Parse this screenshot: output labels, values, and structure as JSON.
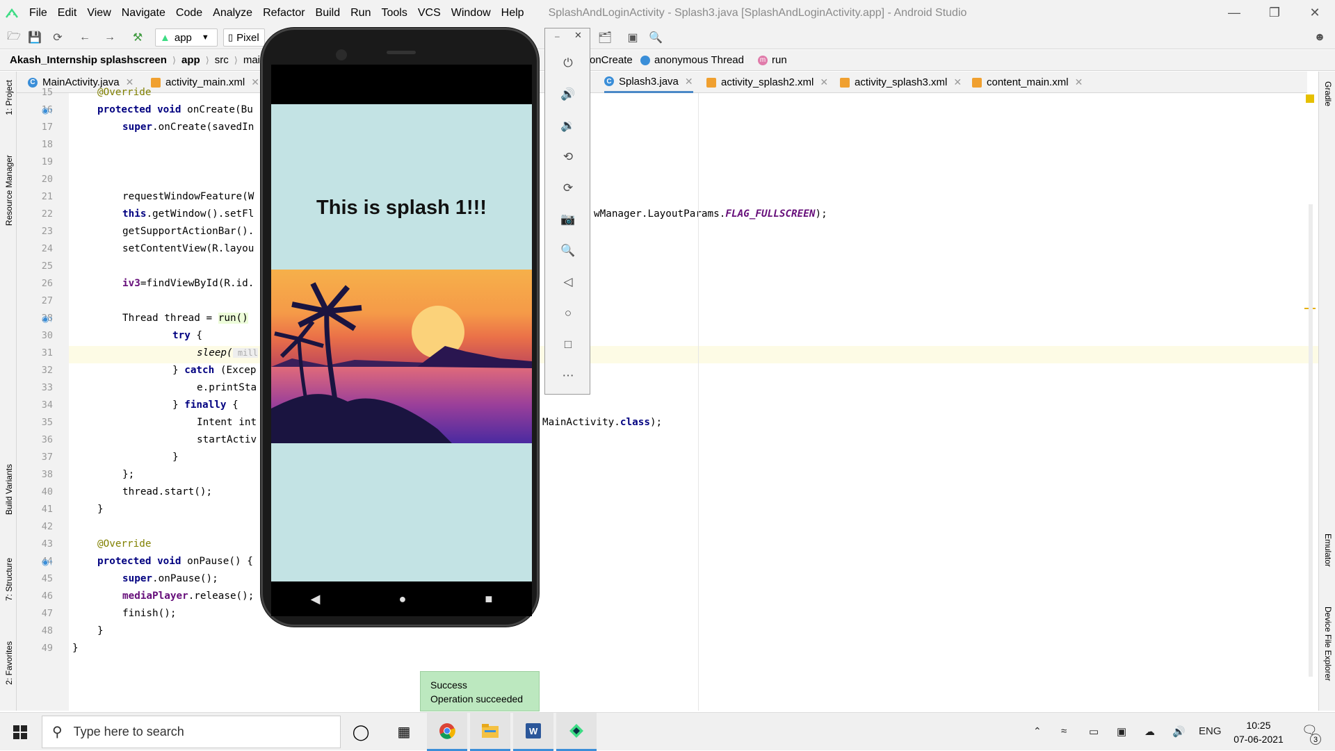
{
  "window": {
    "title": "SplashAndLoginActivity - Splash3.java [SplashAndLoginActivity.app] - Android Studio",
    "menu": [
      "File",
      "Edit",
      "View",
      "Navigate",
      "Code",
      "Analyze",
      "Refactor",
      "Build",
      "Run",
      "Tools",
      "VCS",
      "Window",
      "Help"
    ]
  },
  "toolbar": {
    "run_config": "app",
    "device": "Pixel"
  },
  "breadcrumb": {
    "project": "Akash_Internship splashscreen",
    "module": "app",
    "src": "src",
    "main": "main",
    "method": "onCreate",
    "anon": "anonymous Thread",
    "run": "run"
  },
  "tabs": [
    {
      "label": "MainActivity.java",
      "type": "java"
    },
    {
      "label": "activity_main.xml",
      "type": "xml"
    },
    {
      "label": "Splash3.java",
      "type": "java",
      "active": true
    },
    {
      "label": "activity_splash2.xml",
      "type": "xml"
    },
    {
      "label": "activity_splash3.xml",
      "type": "xml"
    },
    {
      "label": "content_main.xml",
      "type": "xml"
    }
  ],
  "side_tools": {
    "project": "1: Project",
    "resource_manager": "Resource Manager",
    "build_variants": "Build Variants",
    "structure": "7: Structure",
    "favorites": "2: Favorites",
    "gradle": "Gradle",
    "emulator": "Emulator",
    "device_file_explorer": "Device File Explorer"
  },
  "code": {
    "lines": [
      "15",
      "16",
      "17",
      "18",
      "19",
      "20",
      "21",
      "22",
      "23",
      "24",
      "25",
      "26",
      "27",
      "28",
      "30",
      "31",
      "32",
      "33",
      "34",
      "35",
      "36",
      "37",
      "38",
      "40",
      "41",
      "42",
      "43",
      "44",
      "45",
      "46",
      "47",
      "48",
      "49"
    ],
    "l15": "@Override",
    "l16a": "protected ",
    "l16b": "void ",
    "l16c": "onCreate(Bu",
    "l17a": "super",
    "l17b": ".onCreate(savedIn",
    "l21": "requestWindowFeature(W",
    "l22a": "this",
    "l22b": ".getWindow().setFl",
    "l22r1": "wManager.LayoutParams.",
    "l22r2": "FLAG_FULLSCREEN",
    "l22r3": ");",
    "l23": "getSupportActionBar().",
    "l24": "setContentView(R.layou",
    "l26a": "iv3",
    "l26b": "=findViewById(R.id.",
    "l28a": "Thread thread = ",
    "l28b": "run()",
    "l30a": "try",
    "l30b": " {",
    "l31a": "sleep(",
    "l31b": " mill",
    "l32a": "} ",
    "l32b": "catch",
    "l32c": " (Excep",
    "l33": "e.printSta",
    "l34a": "} ",
    "l34b": "finally",
    "l34c": " {",
    "l35": "Intent int",
    "l35r1": "MainActivity.",
    "l35r2": "class",
    "l35r3": ");",
    "l36": "startActiv",
    "l37": "}",
    "l38": "};",
    "l40": "thread.start();",
    "l41": "}",
    "l43": "@Override",
    "l44a": "protected ",
    "l44b": "void ",
    "l44c": "onPause() {",
    "l45a": "super",
    "l45b": ".onPause();",
    "l46a": "mediaPlayer",
    "l46b": ".release();",
    "l47": "finish();",
    "l48": "}",
    "l49": "}"
  },
  "emulator": {
    "splash_text": "This is splash 1!!!",
    "controls": [
      "power-icon",
      "volume-up-icon",
      "volume-down-icon",
      "rotate-left-icon",
      "rotate-right-icon",
      "camera-icon",
      "zoom-icon",
      "back-icon",
      "home-icon",
      "overview-icon",
      "more-icon"
    ]
  },
  "toast": {
    "title": "Success",
    "message": "Operation succeeded"
  },
  "taskbar": {
    "search_placeholder": "Type here to search",
    "language": "ENG",
    "time": "10:25",
    "date": "07-06-2021",
    "notifications": "3"
  },
  "colors": {
    "keyword": "#000080",
    "annotation": "#808000",
    "field": "#660e7a",
    "accent": "#3a8ed8",
    "splash_bg": "#c3e3e4"
  }
}
